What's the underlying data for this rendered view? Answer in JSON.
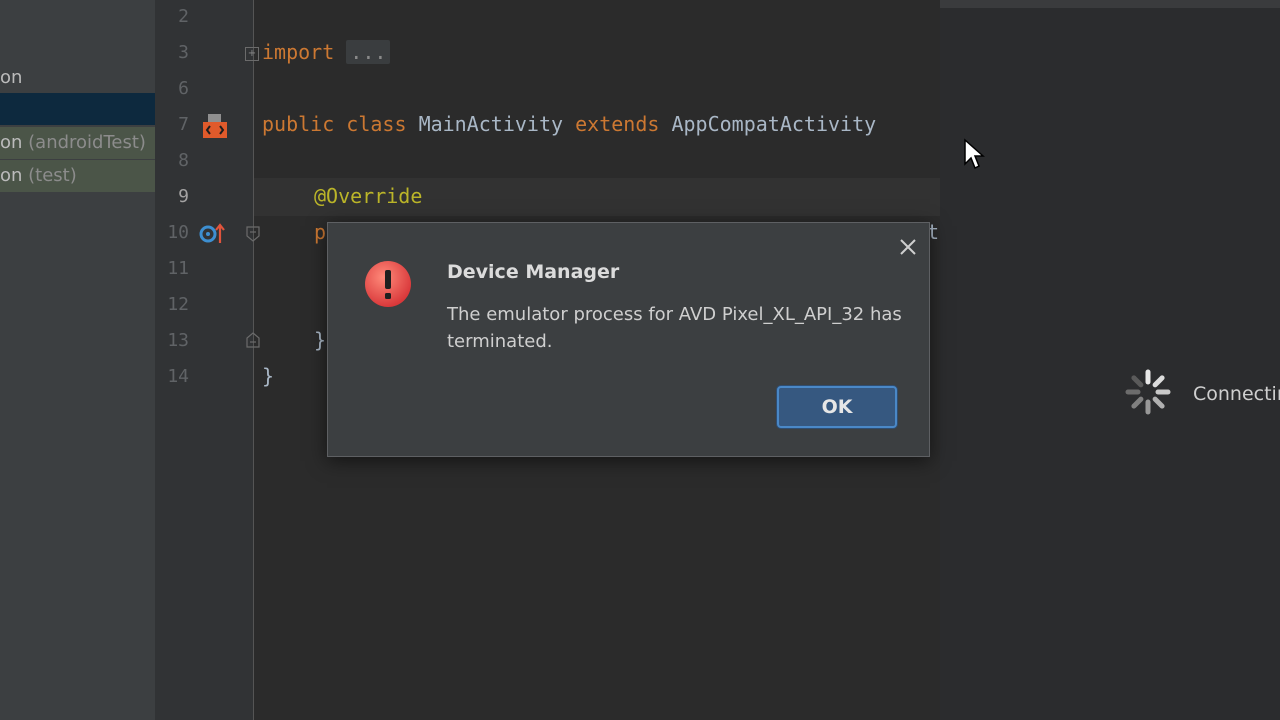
{
  "project_tree": {
    "rows": [
      {
        "label": "on",
        "suffix": ""
      },
      {
        "label": "",
        "suffix": ""
      },
      {
        "label": "on",
        "suffix": " (androidTest)"
      },
      {
        "label": "on",
        "suffix": " (test)"
      }
    ]
  },
  "editor": {
    "line_numbers": [
      "2",
      "3",
      "6",
      "7",
      "8",
      "9",
      "10",
      "11",
      "12",
      "13",
      "14"
    ],
    "active_line": "9",
    "code": {
      "import_keyword": "import",
      "import_folded": "...",
      "class_kw_public": "public",
      "class_kw_class": "class",
      "class_name": "MainActivity",
      "class_kw_extends": "extends",
      "class_super": "AppCompatActivity",
      "annotation": "@Override",
      "method_start": "p",
      "method_tail": "t",
      "inner_brace_close": "}",
      "outer_brace_close": "}"
    }
  },
  "emulator": {
    "status_label": "Connectin"
  },
  "dialog": {
    "title": "Device Manager",
    "message": "The emulator process for AVD Pixel_XL_API_32 has terminated.",
    "ok_label": "OK",
    "icon": "error-icon",
    "accent_color": "#365880"
  }
}
